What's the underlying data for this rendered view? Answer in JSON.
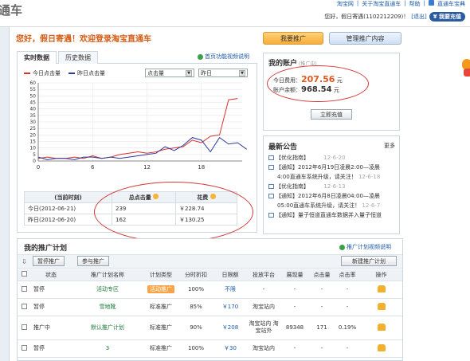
{
  "header": {
    "logo": "通车",
    "links": [
      "淘宝网",
      "关于淘宝直通车",
      "帮助",
      "直通车宝典"
    ],
    "greeting": "您好，假日寄遇(1102212209)！",
    "logout": "[退出]",
    "charge_btn": "我要充值"
  },
  "welcome": "您好，假日寄遇！欢迎登录淘宝直通车",
  "top_buttons": {
    "promote": "我要推广",
    "manage": "管理推广内容"
  },
  "tabs": [
    "实时数据",
    "历史数据"
  ],
  "video_link": "首页功能视频说明",
  "chart_legend": {
    "today": "今日点击量",
    "yesterday": "昨日点击量"
  },
  "selects": {
    "metric": "点击量",
    "compare": "昨日"
  },
  "chart_data": {
    "type": "line",
    "x": [
      0,
      1,
      2,
      3,
      4,
      5,
      6,
      7,
      8,
      9,
      10,
      11,
      12,
      13,
      14,
      15,
      16,
      17,
      18,
      19,
      20,
      21,
      22,
      23
    ],
    "xticks": [
      "0",
      "6",
      "12",
      "18"
    ],
    "yticks": [
      "60",
      "55",
      "50",
      "45",
      "40",
      "35",
      "30",
      "25",
      "20",
      "15",
      "10",
      "5",
      "0"
    ],
    "ylim": [
      0,
      60
    ],
    "series": [
      {
        "name": "今日点击量",
        "color": "#d9302c",
        "values": [
          2,
          3,
          2,
          2,
          3,
          2,
          4,
          2,
          3,
          5,
          6,
          7,
          6,
          7,
          9,
          10,
          11,
          16,
          14,
          19,
          20,
          47,
          48,
          null
        ]
      },
      {
        "name": "昨日点击量",
        "color": "#2a3a9a",
        "values": [
          3,
          1,
          2,
          2,
          1,
          3,
          3,
          2,
          3,
          2,
          3,
          4,
          5,
          6,
          11,
          8,
          12,
          18,
          16,
          7,
          18,
          13,
          14,
          9
        ]
      }
    ]
  },
  "stats_table": {
    "headers": [
      "(当前时刻)",
      "总点击量",
      "花费"
    ],
    "rows": [
      [
        "今日(2012-06-21)",
        "239",
        "￥228.74"
      ],
      [
        "昨日(2012-06-20)",
        "162",
        "￥130.25"
      ]
    ]
  },
  "account": {
    "title": "我的账户",
    "subtitle": "(推广中)",
    "fee_label": "今日费用：",
    "fee_value": "207.56",
    "fee_unit": "元",
    "balance_label": "账户余额：",
    "balance_value": "968.54",
    "balance_unit": "元",
    "recharge_btn": "立即充值"
  },
  "notices": {
    "title": "最新公告",
    "more": "更多",
    "items": [
      {
        "text": "【优化指南】",
        "date": "12-6-20"
      },
      {
        "text": "【通知】2012年6月19日凌晨2:00—凌晨",
        "date": ""
      },
      {
        "text": "4:00直通车系统升级，请关注！",
        "date": "12-6-18"
      },
      {
        "text": "【优化指南】",
        "date": "12-6-13"
      },
      {
        "text": "【通知】2012年6月8日凌晨04:00—凌晨",
        "date": ""
      },
      {
        "text": "05:00直通车系统升级，请关注！",
        "date": "12-6-7"
      },
      {
        "text": "【通知】量子恒道直通车数据并入量子恒道",
        "date": ""
      }
    ]
  },
  "plans": {
    "title": "我的推广计划",
    "video_link": "推广计划视频说明",
    "pause_btn": "暂停推广",
    "join_btn": "参与推广",
    "new_btn": "新建推广计划",
    "headers": [
      "状态",
      "推广计划名称",
      "计划类型",
      "分时折扣",
      "日限额",
      "投放平台",
      "展现量",
      "点击量",
      "点击率",
      "操作"
    ],
    "rows": [
      [
        "暂停",
        "活动专区",
        "活动推广",
        "100%",
        "不限",
        "-",
        "-",
        "-",
        "-"
      ],
      [
        "暂停",
        "雪地靴",
        "标准推广",
        "85%",
        "￥170",
        "淘宝站内",
        "-",
        "-",
        "-"
      ],
      [
        "推广中",
        "默认推广计划",
        "标准推广",
        "90%",
        "￥208",
        "淘宝站内 淘宝站外",
        "89348",
        "171",
        "0.19%"
      ],
      [
        "暂停",
        "3",
        "标准推广",
        "100%",
        "￥30",
        "淘宝站内",
        "-",
        "-",
        "-"
      ]
    ]
  }
}
